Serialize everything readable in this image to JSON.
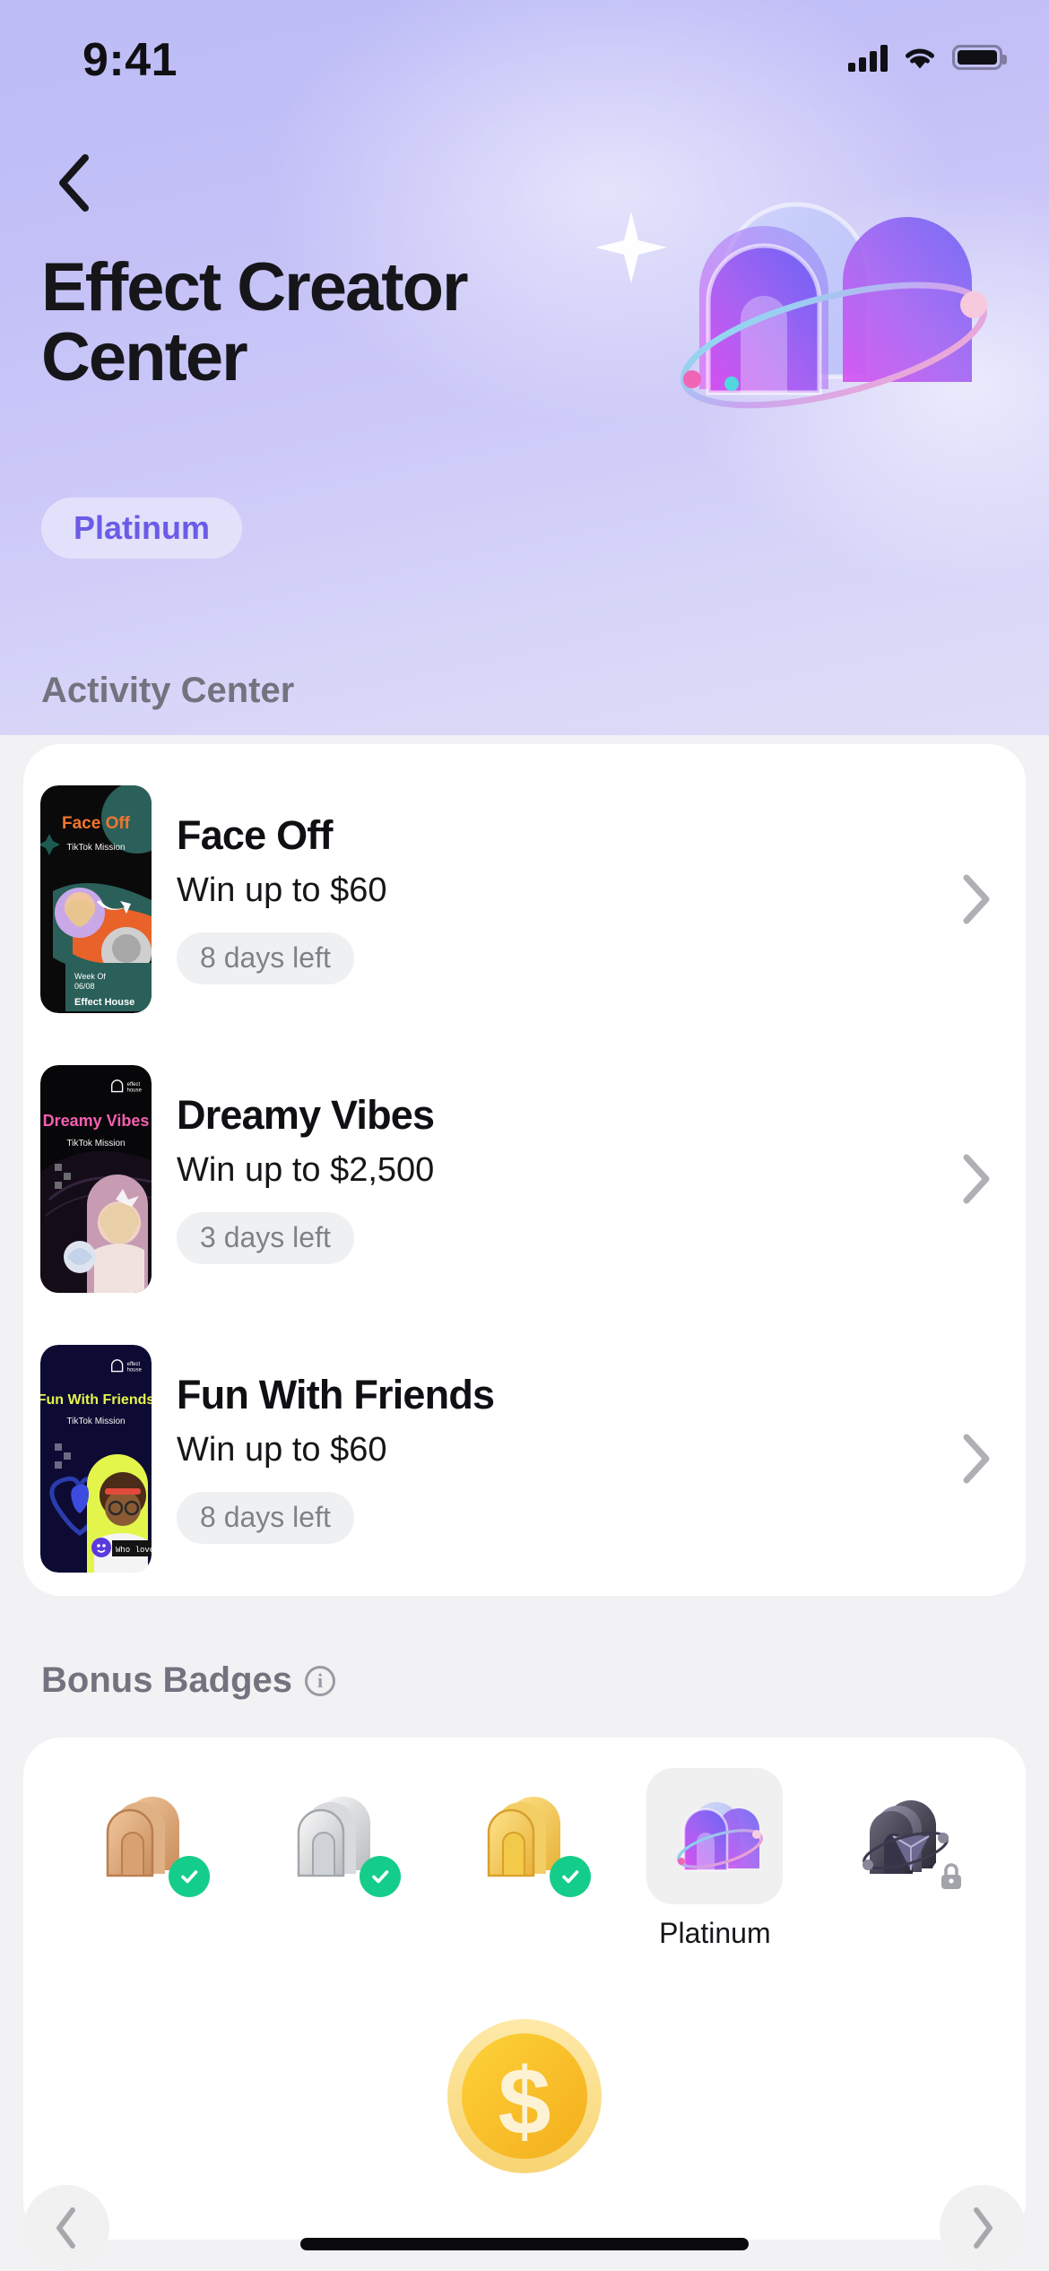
{
  "status_bar": {
    "time": "9:41",
    "cellular_icon": "signal-bars-icon",
    "wifi_icon": "wifi-icon",
    "battery_icon": "battery-full-icon"
  },
  "header": {
    "back_icon": "back-chevron-icon",
    "title": "Effect Creator Center",
    "tier_badge": "Platinum",
    "hero_art": "platinum-arch-3d-icon"
  },
  "activity_section": {
    "heading": "Activity Center",
    "items": [
      {
        "thumb_name": "face-off-mission-thumbnail",
        "thumb_title": "Face Off",
        "thumb_subtitle": "TikTok Mission",
        "thumb_week": "Week Of",
        "thumb_date": "06/08",
        "thumb_brand": "Effect House",
        "title": "Face Off",
        "subtitle": "Win up to $60",
        "days_left": "8 days left",
        "chevron_icon": "chevron-right-icon"
      },
      {
        "thumb_name": "dreamy-vibes-mission-thumbnail",
        "thumb_title": "Dreamy Vibes",
        "thumb_subtitle": "TikTok Mission",
        "thumb_brand": "effect house",
        "title": "Dreamy Vibes",
        "subtitle": "Win up to $2,500",
        "days_left": "3 days left",
        "chevron_icon": "chevron-right-icon"
      },
      {
        "thumb_name": "fun-with-friends-mission-thumbnail",
        "thumb_title": "Fun With Friends",
        "thumb_subtitle": "TikTok Mission",
        "thumb_brand": "effect house",
        "thumb_caption": "Who loves me",
        "title": "Fun With Friends",
        "subtitle": "Win up to $60",
        "days_left": "8 days left",
        "chevron_icon": "chevron-right-icon"
      }
    ]
  },
  "badges_section": {
    "heading": "Bonus Badges",
    "info_icon": "info-circle-icon",
    "info_glyph": "i",
    "badges": [
      {
        "name": "bronze-badge",
        "label": "",
        "state": "earned",
        "status_icon": "check-circle-icon",
        "selected": false
      },
      {
        "name": "silver-badge",
        "label": "",
        "state": "earned",
        "status_icon": "check-circle-icon",
        "selected": false
      },
      {
        "name": "gold-badge",
        "label": "",
        "state": "earned",
        "status_icon": "check-circle-icon",
        "selected": false
      },
      {
        "name": "platinum-badge",
        "label": "Platinum",
        "state": "current",
        "status_icon": "",
        "selected": true
      },
      {
        "name": "diamond-badge",
        "label": "",
        "state": "locked",
        "status_icon": "lock-icon",
        "selected": false
      }
    ],
    "reward_icon": "gold-coin-dollar-icon",
    "prev_icon": "chevron-left-icon",
    "next_icon": "chevron-right-icon"
  },
  "colors": {
    "hero_gradient_start": "#bcbcf6",
    "hero_gradient_end": "#dedcf6",
    "accent_purple": "#6b5ce7",
    "page_background": "#f2f2f4",
    "card_background": "#ffffff",
    "chip_background": "#eff0f1",
    "chip_text": "#818189",
    "heading_text": "#73737f",
    "body_text": "#16161a",
    "check_green": "#15cd8a",
    "coin_gold": "#fbc72a",
    "lock_gray": "#9a9aa4"
  }
}
